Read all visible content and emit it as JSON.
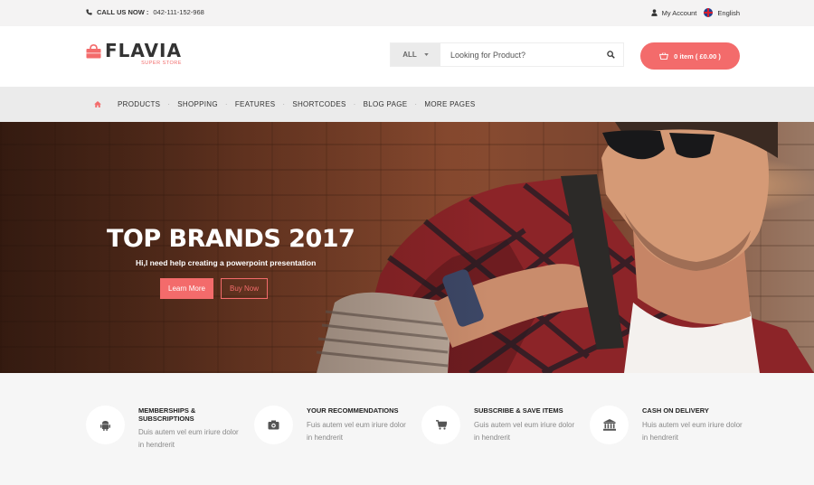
{
  "topbar": {
    "call_label": "CALL US NOW :",
    "phone": "042-111-152-968",
    "account": "My Account",
    "language": "English"
  },
  "header": {
    "logo_name": "FLAVIA",
    "logo_sub": "SUPER STORE",
    "search_category": "ALL",
    "search_placeholder": "Looking for Product?",
    "cart_label": "0 item  ( £0.00 )"
  },
  "nav": {
    "items": [
      "PRODUCTS",
      "SHOPPING",
      "FEATURES",
      "SHORTCODES",
      "BLOG PAGE",
      "MORE PAGES"
    ]
  },
  "hero": {
    "title": "TOP BRANDS 2017",
    "subtitle": "Hi,I need help creating a powerpoint presentation",
    "learn_more": "Learn More",
    "buy_now": "Buy Now"
  },
  "features": [
    {
      "icon": "android-icon",
      "title": "MEMBERSHIPS & SUBSCRIPTIONS",
      "desc": "Duis autem vel eum iriure dolor in hendrerit"
    },
    {
      "icon": "camera-icon",
      "title": "YOUR RECOMMENDATIONS",
      "desc": "Fuis autem vel eum iriure dolor in hendrerit"
    },
    {
      "icon": "cart-icon",
      "title": "SUBSCRIBE & SAVE ITEMS",
      "desc": "Guis autem vel eum iriure dolor in hendrerit"
    },
    {
      "icon": "bank-icon",
      "title": "CASH ON DELIVERY",
      "desc": "Huis autem vel eum iriure dolor in hendrerit"
    }
  ],
  "colors": {
    "accent": "#f36b6b",
    "topbar_bg": "#f4f3f3",
    "nav_bg": "#ebebeb"
  }
}
